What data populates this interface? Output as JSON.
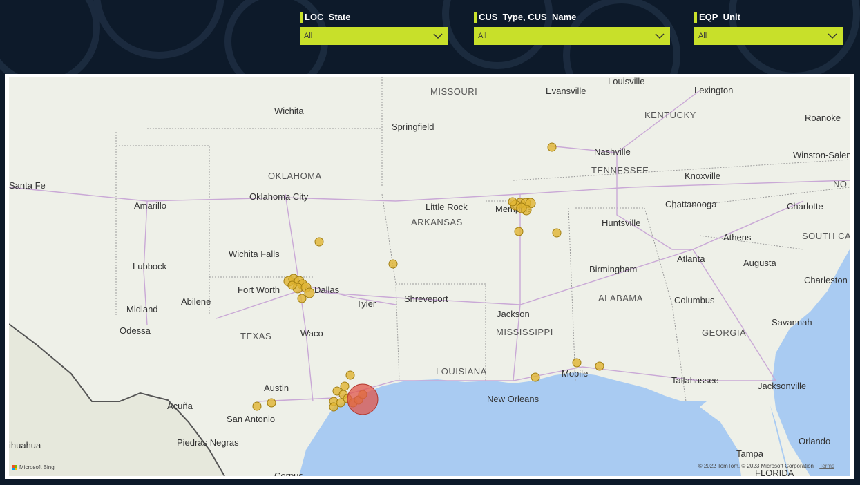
{
  "slicers": [
    {
      "title": "LOC_State",
      "value": "All"
    },
    {
      "title": "CUS_Type, CUS_Name",
      "value": "All"
    },
    {
      "title": "EQP_Unit",
      "value": "All"
    }
  ],
  "map": {
    "states": [
      "MISSOURI",
      "KENTUCKY",
      "TENNESSEE",
      "OKLAHOMA",
      "ARKANSAS",
      "TEXAS",
      "LOUISIANA",
      "MISSISSIPPI",
      "ALABAMA",
      "GEORGIA",
      "SOUTH CAROLINA",
      "NO"
    ],
    "cities": [
      "Louisville",
      "Evansville",
      "Lexington",
      "Wichita",
      "Springfield",
      "Roanoke",
      "Nashville",
      "Winston-Salem",
      "Santa Fe",
      "Oklahoma City",
      "Knoxville",
      "Amarillo",
      "Little Rock",
      "Memphis",
      "Chattanooga",
      "Charlotte",
      "Huntsville",
      "Athens",
      "Wichita Falls",
      "Atlanta",
      "Augusta",
      "Lubbock",
      "Birmingham",
      "Charleston",
      "Fort Worth",
      "Dallas",
      "Tyler",
      "Shreveport",
      "Abilene",
      "Midland",
      "Jackson",
      "Columbus",
      "Odessa",
      "Savannah",
      "Waco",
      "Austin",
      "Mobile",
      "Tallahassee",
      "Jacksonville",
      "New Orleans",
      "Acuña",
      "San Antonio",
      "Piedras Negras",
      "Orlando",
      "Tampa",
      "Corpus",
      "ihuahua",
      "FLORIDA"
    ],
    "legend_colors": {
      "small_bubble": "#e0b431",
      "large_bubble": "#e0564a",
      "water": "#a9cbf2",
      "land": "#eef0e8"
    },
    "attribution": {
      "logo": "Microsoft Bing",
      "copyright": "© 2022 TomTom, © 2023 Microsoft Corporation",
      "terms": "Terms"
    }
  }
}
